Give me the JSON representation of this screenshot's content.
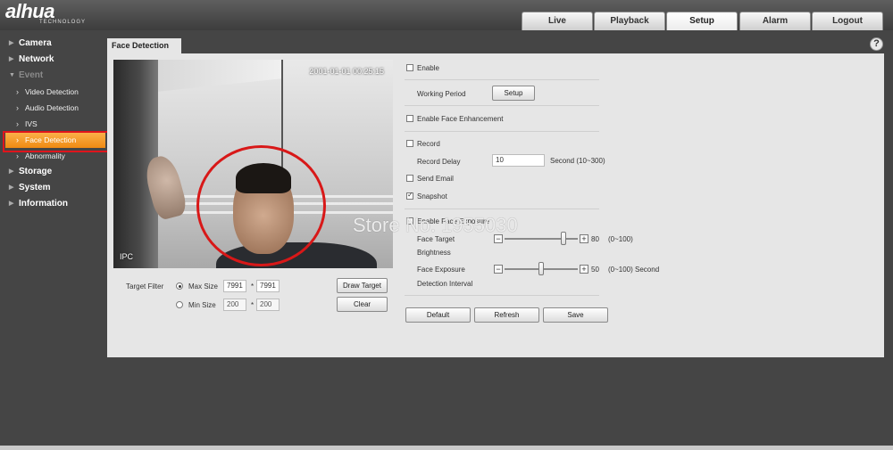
{
  "header": {
    "logo": "alhua",
    "logo_sub": "TECHNOLOGY",
    "tabs": [
      {
        "label": "Live"
      },
      {
        "label": "Playback"
      },
      {
        "label": "Setup"
      },
      {
        "label": "Alarm"
      },
      {
        "label": "Logout"
      }
    ],
    "active_tab": "Setup"
  },
  "sidebar": {
    "items": [
      {
        "label": "Camera"
      },
      {
        "label": "Network"
      },
      {
        "label": "Event"
      },
      {
        "label": "Video Detection"
      },
      {
        "label": "Audio Detection"
      },
      {
        "label": "IVS"
      },
      {
        "label": "Face Detection"
      },
      {
        "label": "Abnormality"
      },
      {
        "label": "Storage"
      },
      {
        "label": "System"
      },
      {
        "label": "Information"
      }
    ],
    "active_item": "Face Detection"
  },
  "panel": {
    "title": "Face Detection",
    "help_icon": "?"
  },
  "video": {
    "timestamp": "2001-01-01 00:25:15",
    "channel_name": "IPC"
  },
  "target_filter": {
    "label": "Target Filter",
    "max_size_label": "Max Size",
    "max_w": "7991",
    "max_h": "7991",
    "min_size_label": "Min Size",
    "min_w": "200",
    "min_h": "200",
    "times": "*",
    "selected": "Max Size",
    "draw_target": "Draw Target",
    "clear": "Clear"
  },
  "settings": {
    "enable": "Enable",
    "working_period": "Working Period",
    "setup_button": "Setup",
    "enable_face_enhancement": "Enable Face Enhancement",
    "record": "Record",
    "record_delay": "Record Delay",
    "record_delay_value": "10",
    "record_delay_unit": "Second (10~300)",
    "send_email": "Send Email",
    "snapshot": "Snapshot",
    "snapshot_checked": true,
    "enable_face_exposure": "Enable Face Exposure",
    "face_target_brightness_1": "Face Target",
    "face_target_brightness_2": "Brightness",
    "brightness_value": "80",
    "brightness_level": 0.8,
    "brightness_range": "(0~100)",
    "face_exposure_1": "Face Exposure",
    "face_exposure_2": "Detection Interval",
    "exposure_value": "50",
    "exposure_level": 0.5,
    "exposure_range": "(0~100) Second",
    "default": "Default",
    "refresh": "Refresh",
    "save": "Save"
  },
  "watermark": "Store No. 1955030",
  "colors": {
    "active_menu": "#f5961d",
    "highlight_border": "#e0141c",
    "face_ring": "#d81818"
  }
}
